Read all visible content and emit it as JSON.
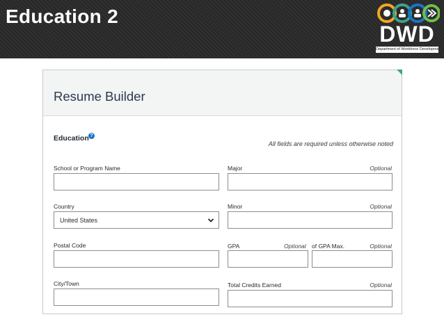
{
  "slide": {
    "title": "Education 2"
  },
  "logo": {
    "word": "DWD",
    "subtitle": "Department of Workforce Development",
    "circle_colors": [
      "#f4a623",
      "#3aa38f",
      "#1a73c8",
      "#6cc04a"
    ]
  },
  "panel": {
    "title": "Resume Builder",
    "accent_color": "#3aa38f"
  },
  "section": {
    "title": "Education",
    "required_note": "All fields are required unless otherwise noted"
  },
  "fields": {
    "school": {
      "label": "School or Program Name",
      "value": ""
    },
    "major": {
      "label": "Major",
      "optional": "Optional",
      "value": ""
    },
    "country": {
      "label": "Country",
      "value": "United States"
    },
    "minor": {
      "label": "Minor",
      "optional": "Optional",
      "value": ""
    },
    "postal": {
      "label": "Postal Code",
      "value": ""
    },
    "gpa": {
      "label": "GPA",
      "optional": "Optional",
      "value": ""
    },
    "gpa_max": {
      "label": "of GPA Max.",
      "optional": "Optional",
      "value": ""
    },
    "city": {
      "label": "City/Town",
      "value": ""
    },
    "credits": {
      "label": "Total Credits Earned",
      "optional": "Optional",
      "value": ""
    }
  },
  "icons": {
    "help": "help-icon",
    "dropdown": "chevron-down-icon"
  }
}
